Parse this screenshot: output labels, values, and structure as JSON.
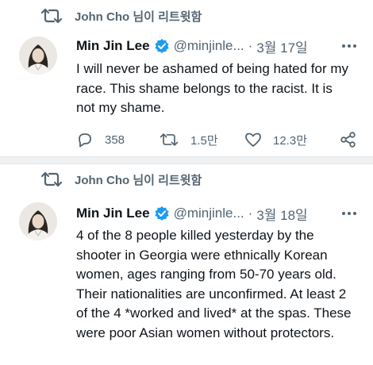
{
  "tweets": [
    {
      "retweeter_text": "John Cho 님이 리트윗함",
      "author_name": "Min Jin Lee",
      "handle": "@minjinle...",
      "separator": "·",
      "date": "3월 17일",
      "body": "I will never be ashamed of being hated for my race. This shame belongs to the racist. It is not my shame.",
      "replies": "358",
      "retweets": "1.5만",
      "likes": "12.3만"
    },
    {
      "retweeter_text": "John Cho 님이 리트윗함",
      "author_name": "Min Jin Lee",
      "handle": "@minjinle...",
      "separator": "·",
      "date": "3월 18일",
      "body": "4 of the 8 people killed yesterday by the shooter in Georgia were ethnically Korean women, ages ranging from 50-70 years old. Their nationalities are unconfirmed. At least 2 of the 4 *worked and lived* at the spas. These were poor Asian women without protectors."
    }
  ],
  "colors": {
    "text": "#0f1419",
    "muted": "#536471",
    "verified": "#1d9bf0",
    "divider": "#eff1f3"
  },
  "icons": [
    "retweet-icon",
    "verified-badge-icon",
    "more-icon",
    "reply-icon",
    "like-icon",
    "share-icon"
  ]
}
